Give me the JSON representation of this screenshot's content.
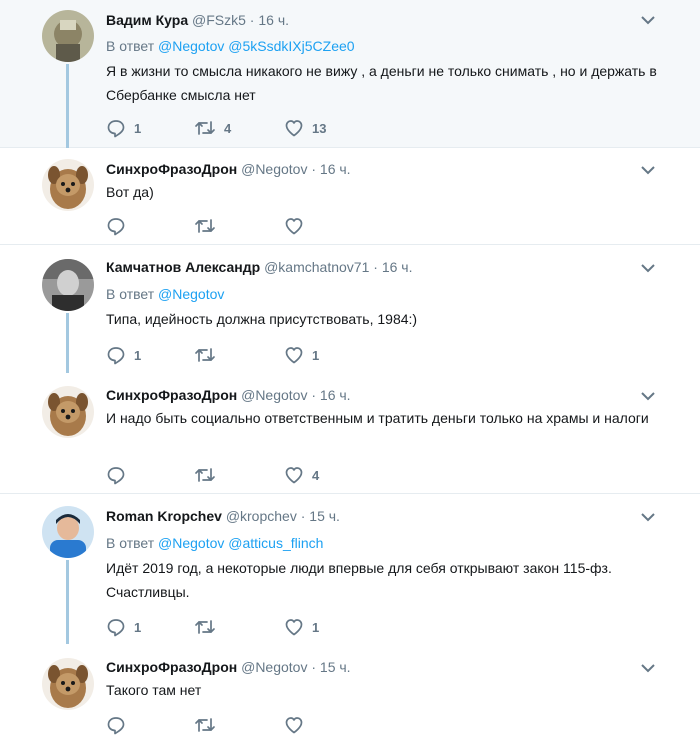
{
  "tweets": [
    {
      "name": "Вадим Кура",
      "handle": "@FSzk5",
      "dot": "·",
      "time": "16 ч.",
      "reply_prefix": "В ответ",
      "reply_mentions": [
        "@Negotov",
        "@5kSsdkIXj5CZee0"
      ],
      "text": "Я в жизни то смысла никакого не вижу , а деньги не только снимать , но и держать в Сбербанке смысла нет",
      "reply_count": "1",
      "retweet_count": "4",
      "like_count": "13"
    },
    {
      "name": "СинхроФразоДрон",
      "handle": "@Negotov",
      "dot": "·",
      "time": "16 ч.",
      "text": "Вот да)",
      "reply_count": "",
      "retweet_count": "",
      "like_count": ""
    },
    {
      "name": "Камчатнов Александр",
      "handle": "@kamchatnov71",
      "dot": "·",
      "time": "16 ч.",
      "reply_prefix": "В ответ",
      "reply_mentions": [
        "@Negotov"
      ],
      "text": "Типа, идейность должна присутствовать, 1984:)",
      "reply_count": "1",
      "retweet_count": "",
      "like_count": "1"
    },
    {
      "name": "СинхроФразоДрон",
      "handle": "@Negotov",
      "dot": "·",
      "time": "16 ч.",
      "text": "И надо быть социально ответственным и тратить деньги только на храмы и налоги",
      "reply_count": "",
      "retweet_count": "",
      "like_count": "4"
    },
    {
      "name": "Roman Kropchev",
      "handle": "@kropchev",
      "dot": "·",
      "time": "15 ч.",
      "reply_prefix": "В ответ",
      "reply_mentions": [
        "@Negotov",
        "@atticus_flinch"
      ],
      "text": "Идёт 2019 год, а некоторые люди впервые для себя открывают закон 115-фз. Счастливцы.",
      "reply_count": "1",
      "retweet_count": "",
      "like_count": "1"
    },
    {
      "name": "СинхроФразоДрон",
      "handle": "@Negotov",
      "dot": "·",
      "time": "15 ч.",
      "text": "Такого там нет",
      "reply_count": "",
      "retweet_count": "",
      "like_count": ""
    }
  ],
  "colors": {
    "link": "#1da1f2",
    "secondary_text": "#657786",
    "thread_line": "#a3c8e0",
    "highlight_bg": "#f5f8fa"
  }
}
